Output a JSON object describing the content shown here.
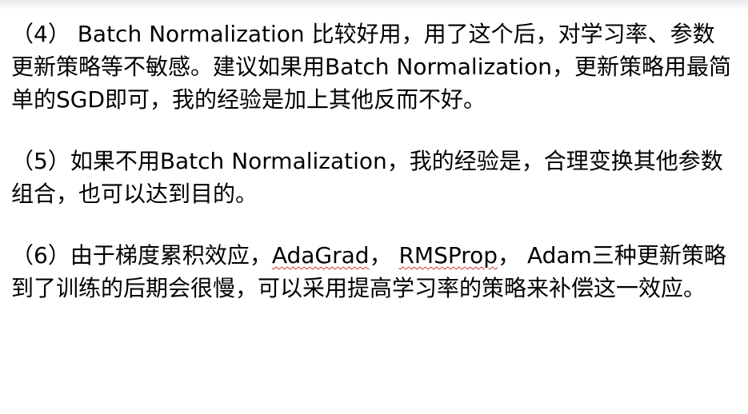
{
  "document": {
    "paragraphs": [
      {
        "segments": [
          "（4） Batch Normalization 比较好用，用了这个后，对学习率、参数更新策略等不敏感。建议如果用Batch Normalization，更新策略用最简单的SGD即可，我的经验是加上其他反而不好。"
        ]
      },
      {
        "segments": [
          "（5）如果不用Batch Normalization，我的经验是，合理变换其他参数组合，也可以达到目的。"
        ]
      },
      {
        "segments": [
          "（6）由于梯度累积效应，",
          "AdaGrad",
          "， ",
          "RMSProp",
          "， Adam三种更新策略到了训练的后期会很慢，可以采用提高学习率的策略来补偿这一效应。"
        ]
      }
    ]
  }
}
